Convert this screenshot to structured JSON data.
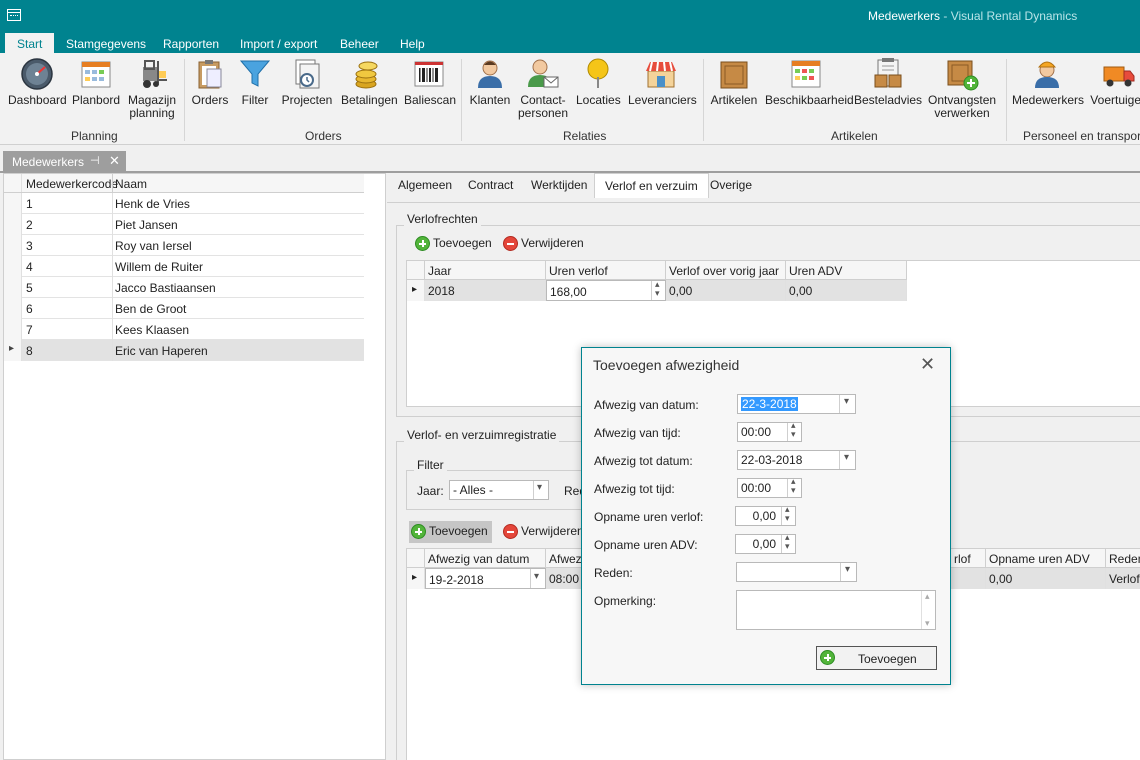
{
  "window": {
    "title": "Medewerkers",
    "app_name": "Visual Rental Dynamics",
    "accent_color": "#00838f"
  },
  "ribbon_tabs": [
    "Start",
    "Stamgegevens",
    "Rapporten",
    "Import / export",
    "Beheer",
    "Help"
  ],
  "ribbon": {
    "groups": {
      "planning": "Planning",
      "orders": "Orders",
      "relaties": "Relaties",
      "artikelen": "Artikelen",
      "personeel": "Personeel en transport"
    },
    "buttons": {
      "dashboard": "Dashboard",
      "planbord": "Planbord",
      "magazijn": "Magazijn planning",
      "orders": "Orders",
      "filter": "Filter",
      "projecten": "Projecten",
      "betalingen": "Betalingen",
      "baliescan": "Baliescan",
      "klanten": "Klanten",
      "contactpersonen": "Contact- personen",
      "locaties": "Locaties",
      "leveranciers": "Leveranciers",
      "artikelen": "Artikelen",
      "beschikbaarheid": "Beschikbaarheid",
      "besteladvies": "Besteladvies",
      "ontvangsten": "Ontvangsten verwerken",
      "medewerkers": "Medewerkers",
      "voertuigen": "Voertuigen"
    }
  },
  "doc_tab": {
    "label": "Medewerkers"
  },
  "employees": {
    "columns": [
      "Medewerkercode",
      "Naam"
    ],
    "rows": [
      {
        "code": "1",
        "name": "Henk de Vries"
      },
      {
        "code": "2",
        "name": "Piet Jansen"
      },
      {
        "code": "3",
        "name": "Roy van Iersel"
      },
      {
        "code": "4",
        "name": "Willem de Ruiter"
      },
      {
        "code": "5",
        "name": "Jacco Bastiaansen"
      },
      {
        "code": "6",
        "name": "Ben de Groot"
      },
      {
        "code": "7",
        "name": "Kees Klaasen"
      },
      {
        "code": "8",
        "name": "Eric van Haperen"
      }
    ],
    "selected_index": 7
  },
  "detail_tabs": [
    "Algemeen",
    "Contract",
    "Werktijden",
    "Verlof en verzuim",
    "Overige"
  ],
  "verlofrechten": {
    "title": "Verlofrechten",
    "add_label": "Toevoegen",
    "remove_label": "Verwijderen",
    "columns": [
      "Jaar",
      "Uren verlof",
      "Verlof over vorig jaar",
      "Uren ADV"
    ],
    "row": {
      "jaar": "2018",
      "uren_verlof": "168,00",
      "vorig_jaar": "0,00",
      "adv": "0,00"
    }
  },
  "registratie": {
    "title": "Verlof- en verzuimregistratie",
    "filter_title": "Filter",
    "jaar_label": "Jaar:",
    "jaar_value": "- Alles -",
    "reden_partial": "Red",
    "add_label": "Toevoegen",
    "remove_label": "Verwijderen",
    "columns": [
      "Afwezig van datum",
      "Afwezi",
      "rlof",
      "Opname uren ADV",
      "Reden"
    ],
    "row": {
      "datum": "19-2-2018",
      "tijd": "08:00",
      "adv": "0,00",
      "reden": "Verlof"
    }
  },
  "dialog": {
    "title": "Toevoegen afwezigheid",
    "fields": {
      "van_datum_label": "Afwezig van datum:",
      "van_datum_value": "22-3-2018",
      "van_tijd_label": "Afwezig van tijd:",
      "van_tijd_value": "00:00",
      "tot_datum_label": "Afwezig tot datum:",
      "tot_datum_value": "22-03-2018",
      "tot_tijd_label": "Afwezig tot tijd:",
      "tot_tijd_value": "00:00",
      "uren_verlof_label": "Opname uren verlof:",
      "uren_verlof_value": "0,00",
      "uren_adv_label": "Opname uren ADV:",
      "uren_adv_value": "0,00",
      "reden_label": "Reden:",
      "reden_value": "",
      "opmerking_label": "Opmerking:",
      "opmerking_value": ""
    },
    "submit_label": "Toevoegen"
  }
}
